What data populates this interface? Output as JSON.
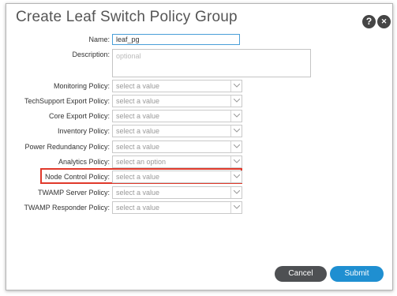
{
  "dialog": {
    "title": "Create Leaf Switch Policy Group",
    "help_icon": "?",
    "close_icon": "✕"
  },
  "form": {
    "name": {
      "label": "Name:",
      "value": "leaf_pg"
    },
    "description": {
      "label": "Description:",
      "placeholder": "optional"
    },
    "selects": [
      {
        "label": "Monitoring Policy:",
        "placeholder": "select a value"
      },
      {
        "label": "TechSupport Export Policy:",
        "placeholder": "select a value"
      },
      {
        "label": "Core Export Policy:",
        "placeholder": "select a value"
      },
      {
        "label": "Inventory Policy:",
        "placeholder": "select a value"
      },
      {
        "label": "Power Redundancy Policy:",
        "placeholder": "select a value"
      },
      {
        "label": "Analytics Policy:",
        "placeholder": "select an option"
      },
      {
        "label": "Node Control Policy:",
        "placeholder": "select a value"
      },
      {
        "label": "TWAMP Server Policy:",
        "placeholder": "select a value"
      },
      {
        "label": "TWAMP Responder Policy:",
        "placeholder": "select a value"
      }
    ]
  },
  "buttons": {
    "cancel": "Cancel",
    "submit": "Submit"
  },
  "colors": {
    "highlight": "#e0392b",
    "submit": "#1f8fd1",
    "cancel": "#4e5053",
    "focus_border": "#4a9fd8"
  }
}
